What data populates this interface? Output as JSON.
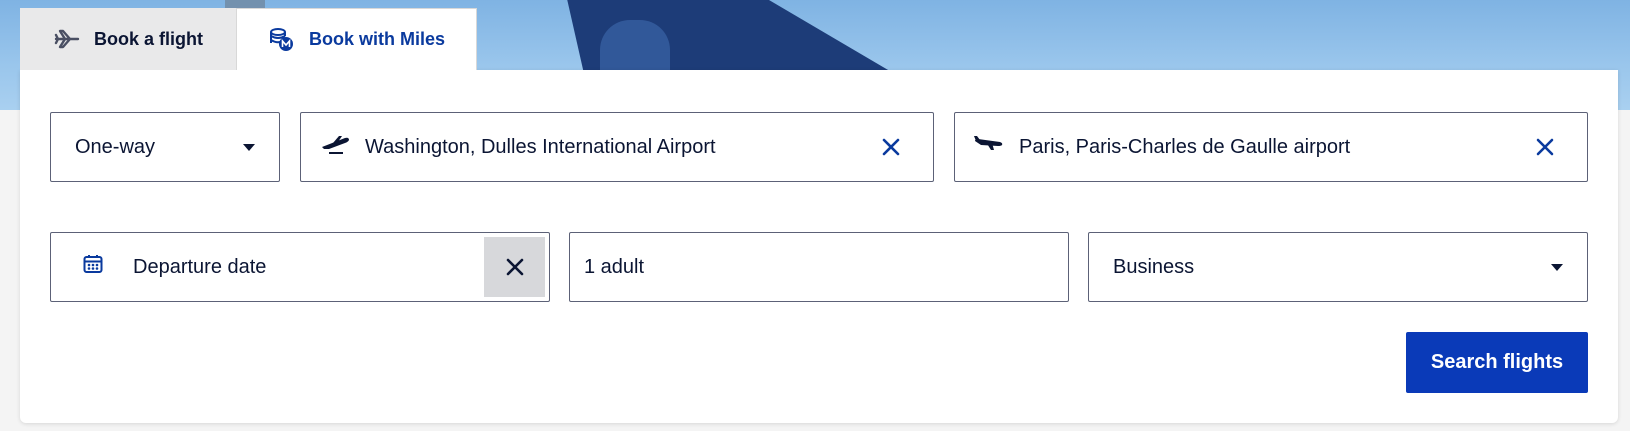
{
  "tabs": [
    {
      "label": "Book a flight",
      "icon": "plane-icon",
      "active": false
    },
    {
      "label": "Book with Miles",
      "icon": "miles-coins-icon",
      "active": true
    }
  ],
  "form": {
    "trip_type": {
      "value": "One-way"
    },
    "origin": {
      "value": "Washington, Dulles International Airport",
      "icon": "takeoff-icon"
    },
    "destination": {
      "value": "Paris, Paris-Charles de Gaulle airport",
      "icon": "landing-icon"
    },
    "departure_date": {
      "value": "Departure date",
      "icon": "calendar-icon"
    },
    "passengers": {
      "value": "1 adult"
    },
    "cabin": {
      "value": "Business"
    },
    "search_label": "Search flights"
  },
  "colors": {
    "brand_blue": "#0a3ab8",
    "icon_blue": "#0a3a9e",
    "text_dark": "#0b1533",
    "border": "#5c6177"
  }
}
